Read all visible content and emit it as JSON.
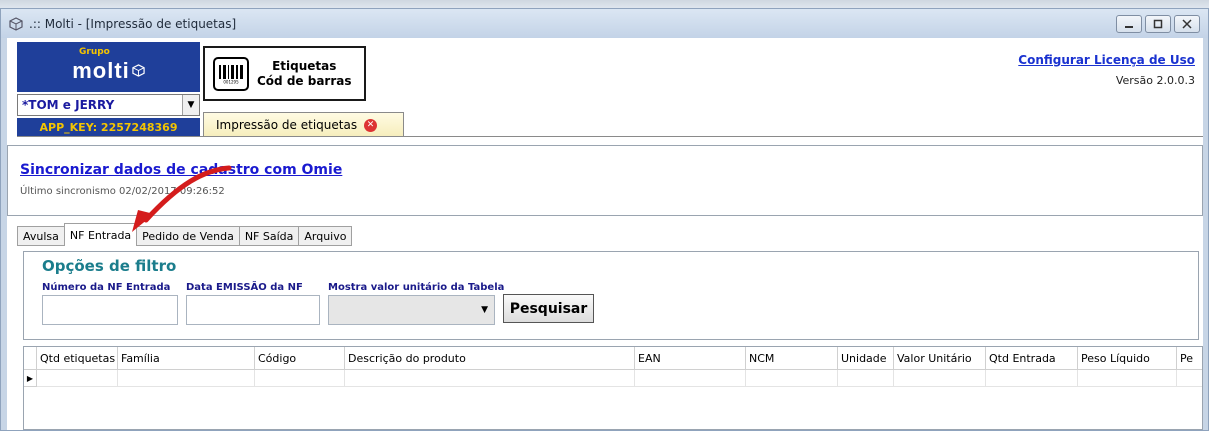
{
  "window": {
    "title": ".:: Molti - [Impressão de etiquetas]"
  },
  "brand": {
    "grupo": "Grupo",
    "name": "molti",
    "company": "*TOM e JERRY",
    "app_key": "APP_KEY: 2257248369"
  },
  "module": {
    "line1": "Etiquetas",
    "line2": "Cód de barras",
    "barcode_number": "001295"
  },
  "doc_tab": {
    "label": "Impressão de etiquetas"
  },
  "header_right": {
    "license_link": "Configurar Licença de Uso",
    "version": "Versão 2.0.0.3"
  },
  "sync": {
    "link": "Sincronizar dados de cadastro com Omie",
    "last": "Último sincronismo 02/02/2017 09:26:52"
  },
  "subtabs": [
    "Avulsa",
    "NF Entrada",
    "Pedido de Venda",
    "NF Saída",
    "Arquivo"
  ],
  "active_subtab": "NF Entrada",
  "filter": {
    "title": "Opções de filtro",
    "nf_label": "Número da NF Entrada",
    "date_label": "Data EMISSÃO da NF",
    "unit_label": "Mostra valor unitário da Tabela",
    "search_button": "Pesquisar"
  },
  "grid": {
    "columns": [
      "Qtd etiquetas",
      "Família",
      "Código",
      "Descrição do produto",
      "EAN",
      "NCM",
      "Unidade",
      "Valor Unitário",
      "Qtd Entrada",
      "Peso Líquido",
      "Pe"
    ]
  },
  "colors": {
    "brand_blue": "#1f3f9a",
    "brand_yellow": "#f4c400",
    "filter_title": "#1b7d8c",
    "link": "#1a32d0",
    "annotation_arrow": "#d41c1c"
  }
}
